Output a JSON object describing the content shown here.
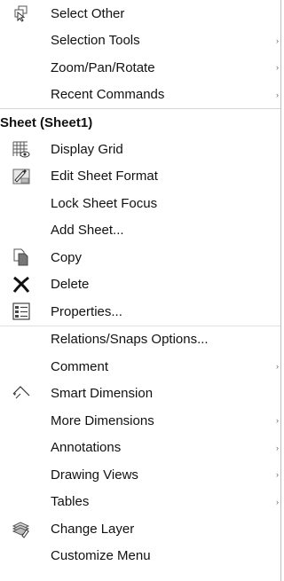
{
  "menu": {
    "items_top": [
      {
        "label": "Select Other",
        "icon": "select-other-icon",
        "submenu": false
      },
      {
        "label": "Selection Tools",
        "icon": "",
        "submenu": true
      },
      {
        "label": "Zoom/Pan/Rotate",
        "icon": "",
        "submenu": true
      },
      {
        "label": "Recent Commands",
        "icon": "",
        "submenu": true
      }
    ],
    "section_title": "Sheet (Sheet1)",
    "items_sheet": [
      {
        "label": "Display Grid",
        "icon": "display-grid-icon",
        "submenu": false
      },
      {
        "label": "Edit Sheet Format",
        "icon": "edit-sheet-format-icon",
        "submenu": false
      },
      {
        "label": "Lock Sheet Focus",
        "icon": "",
        "submenu": false
      },
      {
        "label": "Add Sheet...",
        "icon": "",
        "submenu": false
      },
      {
        "label": "Copy",
        "icon": "copy-icon",
        "submenu": false
      },
      {
        "label": "Delete",
        "icon": "delete-icon",
        "submenu": false
      },
      {
        "label": "Properties...",
        "icon": "properties-icon",
        "submenu": false
      }
    ],
    "items_bottom": [
      {
        "label": "Relations/Snaps Options...",
        "icon": "",
        "submenu": false
      },
      {
        "label": "Comment",
        "icon": "",
        "submenu": true
      },
      {
        "label": "Smart Dimension",
        "icon": "smart-dimension-icon",
        "submenu": false
      },
      {
        "label": "More Dimensions",
        "icon": "",
        "submenu": true
      },
      {
        "label": "Annotations",
        "icon": "",
        "submenu": true
      },
      {
        "label": "Drawing Views",
        "icon": "",
        "submenu": true
      },
      {
        "label": "Tables",
        "icon": "",
        "submenu": true
      },
      {
        "label": "Change Layer",
        "icon": "change-layer-icon",
        "submenu": false
      },
      {
        "label": "Customize Menu",
        "icon": "",
        "submenu": false
      }
    ],
    "arrow_glyph": "›",
    "colors": {
      "text": "#111111",
      "separator": "#d5d5d5"
    }
  }
}
